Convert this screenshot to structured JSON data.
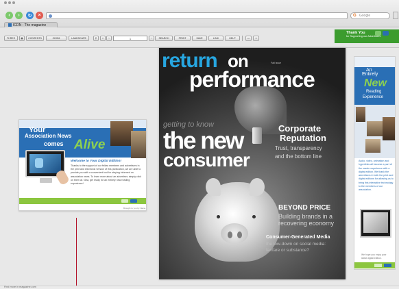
{
  "browser": {
    "tab_title": "ICDN - The magazine",
    "search_placeholder": "Google",
    "colors": {
      "back": "#7cc96c",
      "forward": "#7cc96c",
      "reload": "#3a8ad8",
      "stop": "#e15a4f"
    }
  },
  "toolbar": {
    "buttons": [
      "THREE",
      "CONTENTS",
      "ZOOM",
      "LANDSCAPE",
      "SEARCH",
      "PRINT",
      "SAVE",
      "LINK",
      "HELP"
    ],
    "page_value": "1"
  },
  "thanks": {
    "title": "Thank You",
    "subtitle": "for Supporting our Advertisers"
  },
  "left_page": {
    "line1": "Your",
    "line2": "Association News",
    "line3": "comes",
    "line4": "Alive",
    "welcome": "Welcome to Your Digital Edition!",
    "body": "Thanks to the support of our fellow members and advertisers in the print and electronic version of this publication, we are able to provide you with a convenient tool for staying informed on association news. To learn more about an advertiser, simply click on them at. Now, get ready for an entirely new reading experience!",
    "credit": "Brought to you by Name"
  },
  "cover": {
    "title_return": "return",
    "title_on": "on",
    "title_performance": "performance",
    "issue": "Fall Issue",
    "getting": "getting to know",
    "the_new": "the new",
    "consumer": "consumer",
    "corp1": "Corporate",
    "corp2": "Reputation",
    "corp3": "Trust, transparency",
    "corp4": "and the bottom line",
    "bp1": "BEYOND PRICE",
    "bp2": "Building brands in a",
    "bp3": "recovering economy",
    "cg1": "Consumer-Generated Media",
    "cg2": "the low-down on social media:",
    "cg3": "fanfare or substance?"
  },
  "right_page": {
    "an": "An",
    "entirely": "Entirely",
    "new": "New",
    "reading": "Reading",
    "experience": "Experience",
    "body": "Audio, video, animation and hyperlinks all become a part of the reader experience with a digital edition. We thank the advertisers in both the print and digital editions for allowing us to bring this interactive technology to the members of our association.",
    "hope": "We hope you enjoy your latest digital edition."
  },
  "status": {
    "text": "Find more in magazine.com"
  }
}
